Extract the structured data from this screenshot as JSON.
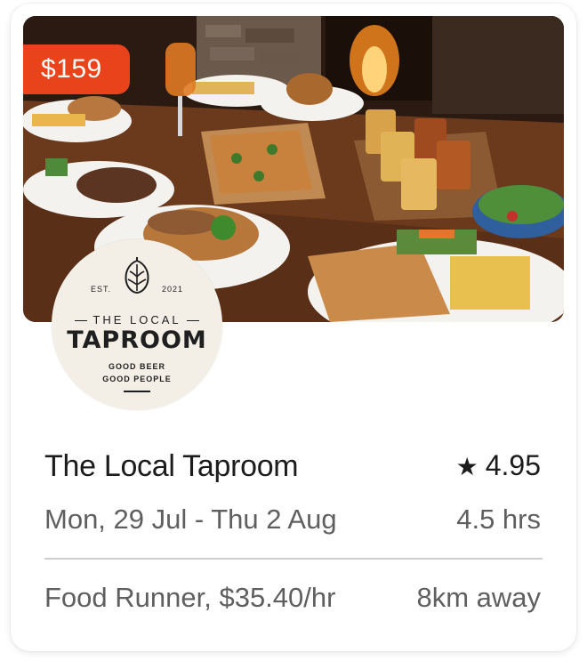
{
  "listing": {
    "price": "$159",
    "title": "The Local Taproom",
    "rating": "4.95",
    "dates": "Mon, 29 Jul - Thu 2 Aug",
    "duration": "4.5 hrs",
    "role": "Food Runner, $35.40/hr",
    "distance": "8km away"
  },
  "logo": {
    "est": "EST.",
    "year": "2021",
    "line1": "THE LOCAL",
    "line2": "TAPROOM",
    "tagline1": "GOOD BEER",
    "tagline2": "GOOD PEOPLE"
  },
  "icons": {
    "rating": "star-icon",
    "logo": "hop-icon"
  },
  "colors": {
    "price_badge": "#e8431a",
    "text_primary": "#1c1c1c",
    "text_secondary": "#5f5f5f"
  }
}
